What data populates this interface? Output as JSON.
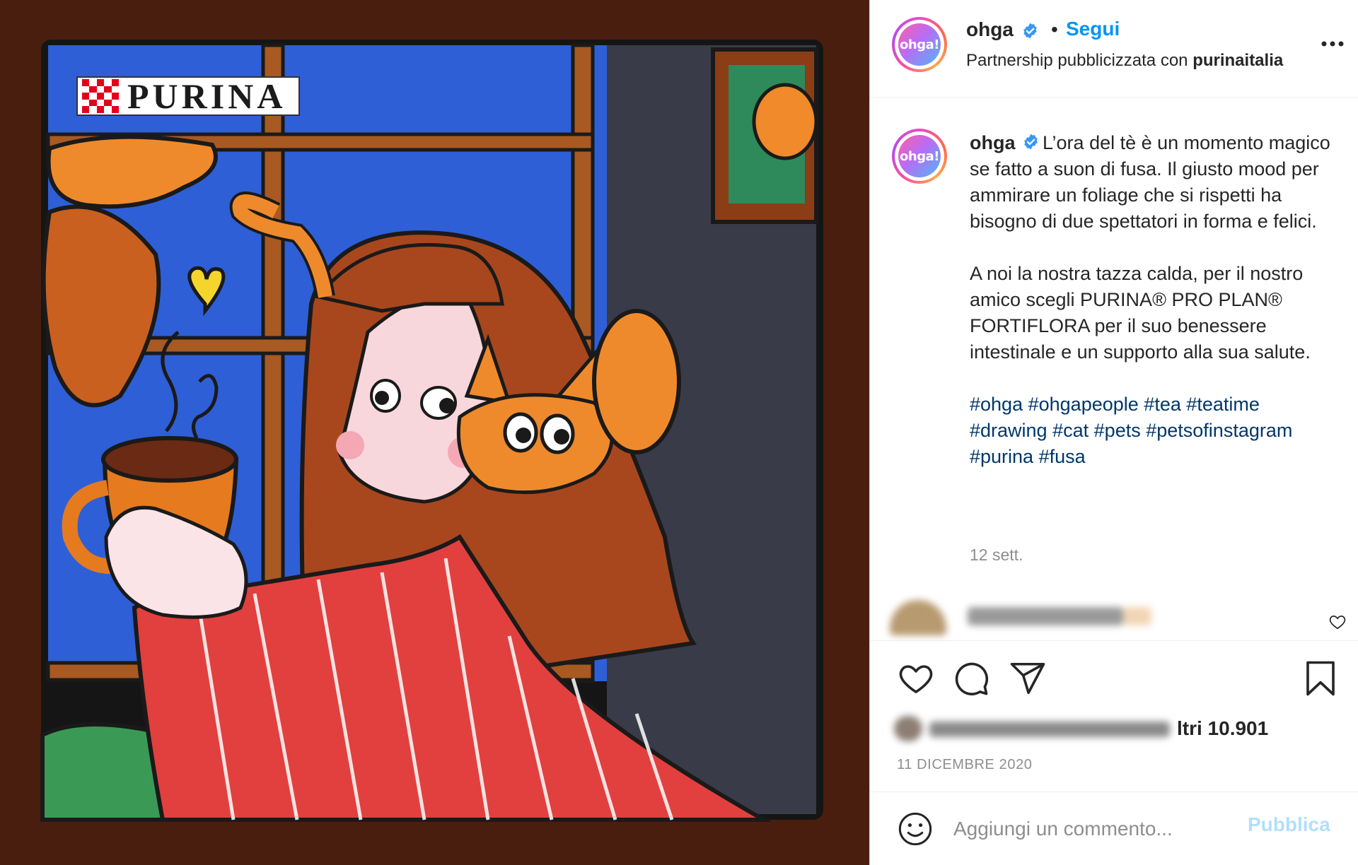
{
  "post": {
    "brand_logo_text": "PURINA"
  },
  "header": {
    "username": "ohga",
    "avatar_text": "ohga!",
    "separator": "•",
    "follow_label": "Segui",
    "partnership_prefix": "Partnership pubblicizzata con",
    "partner": "purinaitalia"
  },
  "caption": {
    "username": "ohga",
    "paragraph_1": "L’ora del tè è un momento magico se fatto a suon di fusa. Il giusto mood per ammirare un foliage che si rispetti ha bisogno di due spettatori in forma e felici.",
    "paragraph_2": "A noi la nostra tazza calda, per il nostro amico scegli PURINA® PRO PLAN® FORTIFLORA per il suo benessere intestinale e un supporto alla sua salute.",
    "hashtags": [
      "#ohga",
      "#ohgapeople",
      "#tea",
      "#teatime",
      "#drawing",
      "#cat",
      "#pets",
      "#petsofinstagram",
      "#purina",
      "#fusa"
    ],
    "age": "12 sett."
  },
  "likes": {
    "text": "ltri 10.901"
  },
  "date": "11 DICEMBRE 2020",
  "comment_box": {
    "placeholder": "Aggiungi un commento...",
    "publish_label": "Pubblica"
  },
  "icons": {
    "verified": "verified-badge-icon",
    "more": "more-options-icon",
    "like": "heart-icon",
    "comment": "comment-bubble-icon",
    "share": "paper-plane-icon",
    "save": "bookmark-icon",
    "emoji": "emoji-smile-icon"
  },
  "colors": {
    "accent": "#0095f6",
    "hashtag": "#00376b",
    "muted": "#8e8e8e",
    "publish_disabled": "#b2dffc"
  }
}
